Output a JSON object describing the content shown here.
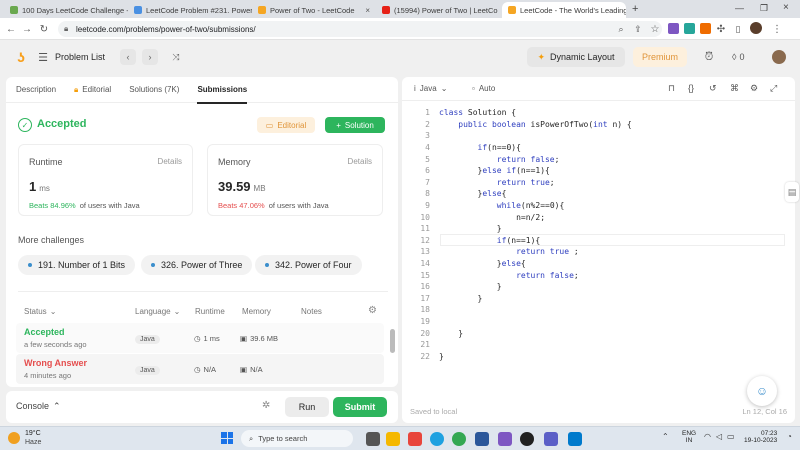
{
  "browser": {
    "tabs": [
      {
        "label": "100 Days LeetCode Challenge -",
        "color": "#6aa84f"
      },
      {
        "label": "LeetCode Problem #231. Power",
        "color": "#4a90e2"
      },
      {
        "label": "Power of Two - LeetCode",
        "color": "#f5a623"
      },
      {
        "label": "(15994) Power of Two | LeetCo",
        "color": "#e62117"
      },
      {
        "label": "LeetCode - The World's Leading",
        "color": "#f5a623"
      }
    ],
    "url": "leetcode.com/problems/power-of-two/submissions/"
  },
  "header": {
    "problem_list": "Problem List",
    "dynamic_layout": "Dynamic Layout",
    "premium": "Premium",
    "streak": "0"
  },
  "left": {
    "tabs": [
      "Description",
      "Editorial",
      "Solutions (7K)",
      "Submissions"
    ],
    "status": "Accepted",
    "editorial_btn": "Editorial",
    "solution_btn": "Solution",
    "runtime": {
      "label": "Runtime",
      "details": "Details",
      "value": "1",
      "unit": "ms",
      "beats": "Beats 84.96%",
      "suffix": "of users with Java"
    },
    "memory": {
      "label": "Memory",
      "details": "Details",
      "value": "39.59",
      "unit": "MB",
      "beats": "Beats 47.06%",
      "suffix": "of users with Java"
    },
    "more_title": "More challenges",
    "challenges": [
      "191. Number of 1 Bits",
      "326. Power of Three",
      "342. Power of Four"
    ],
    "table_headers": {
      "status": "Status",
      "language": "Language",
      "runtime": "Runtime",
      "memory": "Memory",
      "notes": "Notes"
    },
    "rows": [
      {
        "status": "Accepted",
        "time": "a few seconds ago",
        "lang": "Java",
        "runtime": "1 ms",
        "memory": "39.6 MB"
      },
      {
        "status": "Wrong Answer",
        "time": "4 minutes ago",
        "lang": "Java",
        "runtime": "N/A",
        "memory": "N/A"
      }
    ]
  },
  "console": {
    "label": "Console",
    "run": "Run",
    "submit": "Submit"
  },
  "editor": {
    "language": "Java",
    "mode": "Auto",
    "status_left": "Saved to local",
    "status_right": "Ln 12, Col 16",
    "lines": [
      "class Solution {",
      "    public boolean isPowerOfTwo(int n) {",
      "",
      "        if(n==0){",
      "            return false;",
      "        }else if(n==1){",
      "            return true;",
      "        }else{",
      "            while(n%2==0){",
      "                n=n/2;",
      "            }",
      "            if(n==1){",
      "                return true ;",
      "            }else{",
      "                return false;",
      "            }",
      "        }",
      "",
      "",
      "    }",
      "",
      "}"
    ]
  },
  "taskbar": {
    "weather_temp": "19°C",
    "weather_desc": "Haze",
    "search": "Type to search",
    "lang": "ENG",
    "region": "IN",
    "time": "07:23",
    "date": "19-10-2023"
  },
  "colors": {
    "accent_green": "#2db55d",
    "red": "#e54e4e",
    "orange": "#f59e0b"
  }
}
